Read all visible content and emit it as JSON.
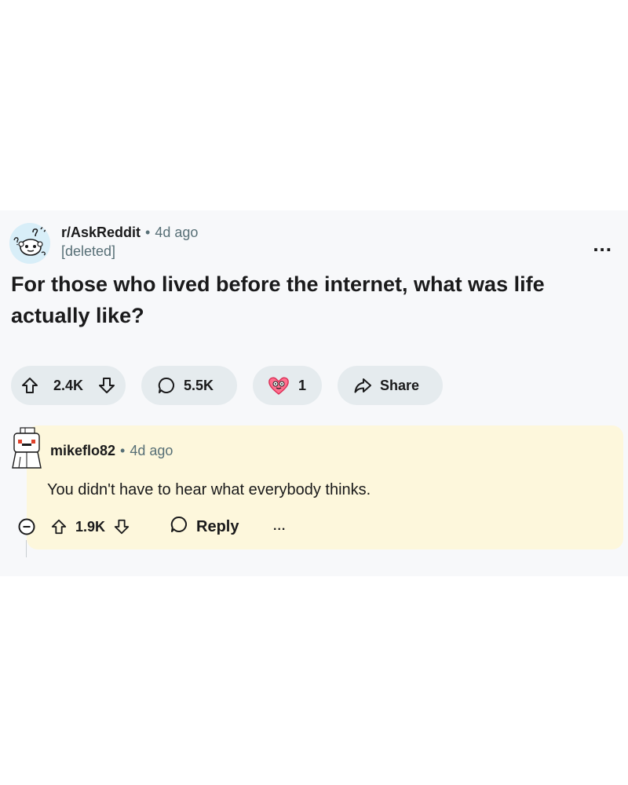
{
  "post": {
    "subreddit": "r/AskReddit",
    "separator": "•",
    "time": "4d ago",
    "author": "[deleted]",
    "more_label": "...",
    "title": "For those who lived before the internet, what was life actually like?",
    "upvotes": "2.4K",
    "comments": "5.5K",
    "awards": "1",
    "share_label": "Share"
  },
  "comment": {
    "username": "mikeflo82",
    "separator": "•",
    "time": "4d ago",
    "body": "You didn't have to hear what everybody thinks.",
    "upvotes": "1.9K",
    "reply_label": "Reply",
    "more_label": "..."
  },
  "colors": {
    "card_bg": "#f7f8fa",
    "pill_bg": "#e5ebee",
    "comment_highlight": "#fdf7dc",
    "muted_text": "#576f76"
  },
  "icons": [
    "askreddit-avatar",
    "upvote-icon",
    "downvote-icon",
    "comment-icon",
    "award-icon",
    "share-icon",
    "collapse-icon",
    "reply-icon",
    "user-avatar"
  ]
}
